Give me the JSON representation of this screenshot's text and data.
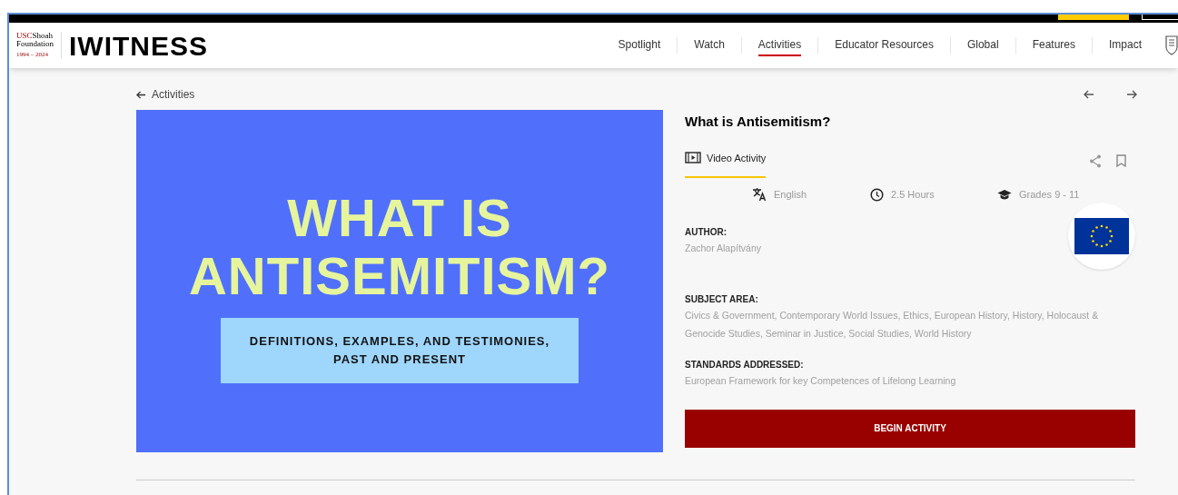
{
  "header": {
    "logo_lines": [
      "USC",
      "Shoah",
      "Foundation",
      "1994 – 2024"
    ],
    "site_name": "IWITNESS",
    "nav": [
      {
        "label": "Spotlight",
        "selected": false
      },
      {
        "label": "Watch",
        "selected": false
      },
      {
        "label": "Activities",
        "selected": true
      },
      {
        "label": "Educator Resources",
        "selected": false
      },
      {
        "label": "Global",
        "selected": false
      },
      {
        "label": "Features",
        "selected": false
      },
      {
        "label": "Impact",
        "selected": false
      }
    ]
  },
  "back_link": "Activities",
  "cover": {
    "headline_lines": [
      "WHAT IS",
      "ANTISEMITISM?"
    ],
    "subtitle_lines": [
      "DEFINITIONS, EXAMPLES, AND TESTIMONIES,",
      "PAST AND PRESENT"
    ]
  },
  "activity": {
    "title": "What is Antisemitism?",
    "type_tab": {
      "label": "Video Activity",
      "selected": true
    },
    "meta": [
      {
        "kind": "language",
        "text": "English"
      },
      {
        "kind": "duration",
        "text": "2.5 Hours"
      },
      {
        "kind": "grades",
        "text": "Grades 9 - 11"
      }
    ],
    "sections": [
      {
        "heading": "AUTHOR:",
        "text": "Zachor Alapítvány"
      },
      {
        "heading": "SUBJECT AREA:",
        "text": "Civics & Government, Contemporary World Issues, Ethics, European History, History, Holocaust & Genocide Studies, Seminar in Justice, Social Studies, World History"
      },
      {
        "heading": "STANDARDS ADDRESSED:",
        "text": "European Framework for key Competences of Lifelong Learning"
      }
    ],
    "button": "BEGIN ACTIVITY"
  }
}
